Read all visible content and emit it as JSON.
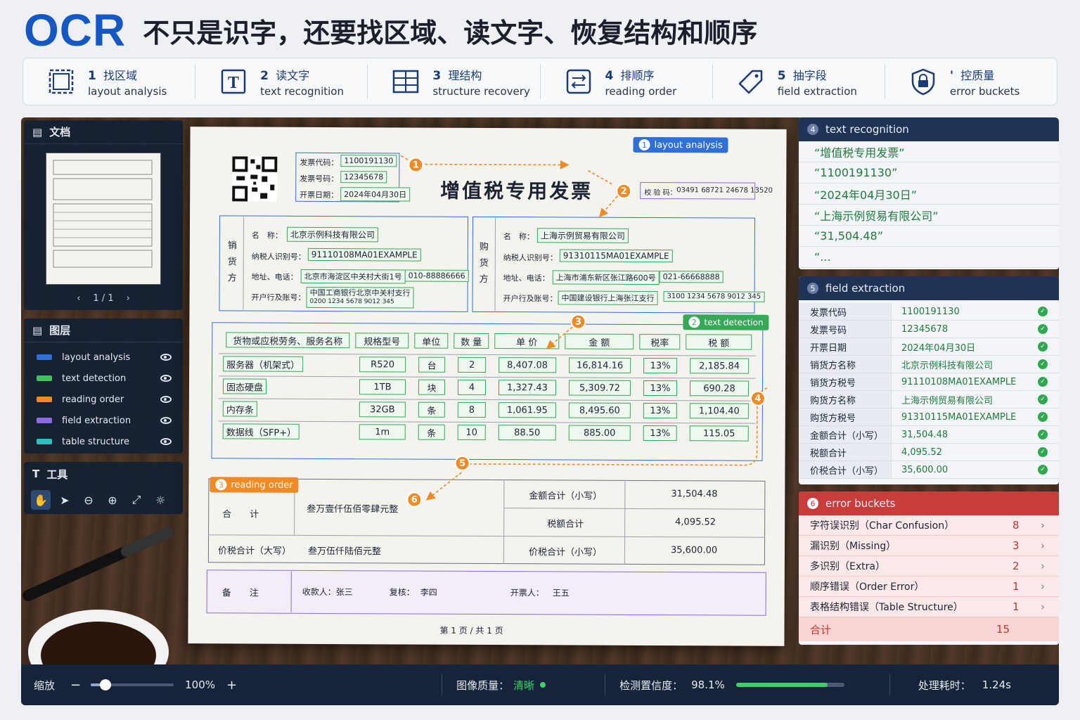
{
  "header": {
    "logo": "OCR",
    "title": "不只是识字，还要找区域、读文字、恢复结构和顺序"
  },
  "steps": [
    {
      "num": "1",
      "zh": "找区域",
      "en": "layout analysis",
      "icon": "layout-icon"
    },
    {
      "num": "2",
      "zh": "读文字",
      "en": "text recognition",
      "icon": "text-T-icon"
    },
    {
      "num": "3",
      "zh": "理结构",
      "en": "structure recovery",
      "icon": "table-grid-icon"
    },
    {
      "num": "4",
      "zh": "排顺序",
      "en": "reading order",
      "icon": "reorder-arrows-icon"
    },
    {
      "num": "5",
      "zh": "抽字段",
      "en": "field extraction",
      "icon": "tag-icon"
    },
    {
      "num": "'",
      "zh": "控质量",
      "en": "error buckets",
      "icon": "shield-icon"
    }
  ],
  "left": {
    "doc_title": "文档",
    "thumb_page": "1 / 1",
    "layers_title": "图层",
    "layers": [
      {
        "label": "layout analysis",
        "color": "#2f6fd8"
      },
      {
        "label": "text detection",
        "color": "#3fbf5f"
      },
      {
        "label": "reading order",
        "color": "#f08a24"
      },
      {
        "label": "field extraction",
        "color": "#8c6be0"
      },
      {
        "label": "table structure",
        "color": "#2fbfbf"
      }
    ],
    "tools_title": "工具"
  },
  "invoice": {
    "title": "增值税专用发票",
    "code_label": "发票代码：",
    "code": "1100191130",
    "num_label": "发票号码：",
    "num": "12345678",
    "date_label": "开票日期：",
    "date": "2024年04月30日",
    "check_label": "校 验 码：",
    "check": "03491 68721 24678 13520",
    "seller_side": "销货方",
    "buyer_side": "购货方",
    "name_label": "名　称：",
    "tax_label": "纳税人识别号：",
    "addr_label": "地址、电话：",
    "bank_label": "开户行及账号：",
    "seller": {
      "name": "北京示例科技有限公司",
      "tax": "91110108MA01EXAMPLE",
      "addr": "北京市海淀区中关村大街1号",
      "phone": "010-88886666",
      "bank": "中国工商银行北京中关村支行",
      "acct": "0200 1234 5678 9012 345"
    },
    "buyer": {
      "name": "上海示例贸易有限公司",
      "tax": "91310115MA01EXAMPLE",
      "addr": "上海市浦东新区张江路600号",
      "phone": "021-66668888",
      "bank": "中国建设银行上海张江支行",
      "acct": "3100 1234 5678 9012 345"
    },
    "headers": [
      "货物或应税劳务、服务名称",
      "规格型号",
      "单位",
      "数 量",
      "单 价",
      "金 额",
      "税率",
      "税 额"
    ],
    "rows": [
      [
        "服务器（机架式）",
        "R520",
        "台",
        "2",
        "8,407.08",
        "16,814.16",
        "13%",
        "2,185.84"
      ],
      [
        "固态硬盘",
        "1TB",
        "块",
        "4",
        "1,327.43",
        "5,309.72",
        "13%",
        "690.28"
      ],
      [
        "内存条",
        "32GB",
        "条",
        "8",
        "1,061.95",
        "8,495.60",
        "13%",
        "1,104.40"
      ],
      [
        "数据线（SFP+）",
        "1m",
        "条",
        "10",
        "88.50",
        "885.00",
        "13%",
        "115.05"
      ]
    ],
    "total_label": "合　　计",
    "total_cn": "叁万壹仟伍佰零肆元整",
    "amount_label": "金额合计（小写）",
    "amount": "31,504.48",
    "tax_total_label": "税额合计",
    "tax_total": "4,095.52",
    "grand_label_big": "价税合计（大写）",
    "grand_cn": "叁万伍仟陆佰元整",
    "grand_label_small": "价税合计（小写）",
    "grand": "35,600.00",
    "remark_label": "备　　注",
    "payee": "收款人：张三",
    "reviewer_label": "复核：",
    "reviewer": "李四",
    "issuer_label": "开票人：",
    "issuer": "王五",
    "page": "第 1 页 / 共 1 页",
    "tag_layout": "layout analysis",
    "tag_detect": "text detection",
    "tag_order": "reading order",
    "order_nums": [
      "1",
      "2",
      "3",
      "4",
      "5",
      "6"
    ],
    "tag_detect_num": "2",
    "tag_layout_num": "1",
    "tag_order_num": "3"
  },
  "right": {
    "rec_num": "4",
    "rec_title": "text recognition",
    "rec_items": [
      "“增值税专用发票”",
      "“1100191130”",
      "“2024年04月30日”",
      "“上海示例贸易有限公司”",
      "“31,504.48”",
      "“..."
    ],
    "fe_num": "5",
    "fe_title": "field extraction",
    "fields": [
      {
        "k": "发票代码",
        "v": "1100191130"
      },
      {
        "k": "发票号码",
        "v": "12345678"
      },
      {
        "k": "开票日期",
        "v": "2024年04月30日"
      },
      {
        "k": "销货方名称",
        "v": "北京示例科技有限公司"
      },
      {
        "k": "销货方税号",
        "v": "91110108MA01EXAMPLE"
      },
      {
        "k": "购货方名称",
        "v": "上海示例贸易有限公司"
      },
      {
        "k": "购货方税号",
        "v": "91310115MA01EXAMPLE"
      },
      {
        "k": "金额合计（小写）",
        "v": "31,504.48"
      },
      {
        "k": "税额合计",
        "v": "4,095.52"
      },
      {
        "k": "价税合计（小写）",
        "v": "35,600.00"
      }
    ],
    "err_num": "6",
    "err_title": "error buckets",
    "errors": [
      {
        "k": "字符误识别（Char Confusion）",
        "n": "8"
      },
      {
        "k": "漏识别（Missing）",
        "n": "3"
      },
      {
        "k": "多识别（Extra）",
        "n": "2"
      },
      {
        "k": "顺序错误（Order Error）",
        "n": "1"
      },
      {
        "k": "表格结构错误（Table Structure）",
        "n": "1"
      }
    ],
    "err_total_label": "合计",
    "err_total": "15"
  },
  "bottom": {
    "zoom_label": "缩放",
    "zoom": "100%",
    "zoom_level": 0.18,
    "quality_label": "图像质量：",
    "quality": "清晰",
    "conf_label": "检测置信度：",
    "conf": "98.1%",
    "conf_level": 0.981,
    "time_label": "处理耗时：",
    "time": "1.24s"
  }
}
